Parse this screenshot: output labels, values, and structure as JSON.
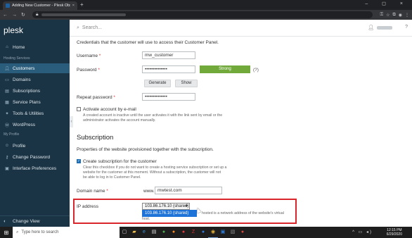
{
  "browser": {
    "tab_title": "Adding New Customer - Plesk Obsidian",
    "tab_close": "×",
    "new_tab": "+",
    "window_controls": "– ◻ ×"
  },
  "sidebar": {
    "logo": "plesk",
    "section_hosting": "Hosting Services",
    "items_hosting": [
      {
        "label": "Home",
        "icon": "home-icon"
      },
      {
        "label": "Customers",
        "icon": "person-icon",
        "active": true
      },
      {
        "label": "Domains",
        "icon": "globe-icon"
      },
      {
        "label": "Subscriptions",
        "icon": "subscriptions-icon"
      },
      {
        "label": "Service Plans",
        "icon": "plans-icon"
      },
      {
        "label": "Tools & Utilities",
        "icon": "tools-icon"
      },
      {
        "label": "WordPress",
        "icon": "wordpress-icon"
      }
    ],
    "section_profile": "My Profile",
    "items_profile": [
      {
        "label": "Profile",
        "icon": "profile-icon"
      },
      {
        "label": "Change Password",
        "icon": "key-icon"
      },
      {
        "label": "Interface Preferences",
        "icon": "preferences-icon"
      }
    ],
    "footer": "Change View"
  },
  "topbar": {
    "search_placeholder": "Search..."
  },
  "form": {
    "intro": "Credentials that the customer will use to access their Customer Panel.",
    "username_label": "Username",
    "username_value": "mw_customer",
    "password_label": "Password",
    "password_value": "••••••••••••••",
    "strength": "Strong",
    "help_mark": "(?)",
    "generate_label": "Generate",
    "show_label": "Show",
    "repeat_label": "Repeat password",
    "repeat_value": "••••••••••••••",
    "activate_label": "Activate account by e-mail",
    "activate_hint_1": "A created account is inactive until the user activates it with the link sent by email or the",
    "activate_hint_2": "administrator activates the account manually.",
    "subscription_heading": "Subscription",
    "subscription_intro": "Properties of the website provisioned together with the subscription.",
    "create_sub_label": "Create subscription for the customer",
    "create_sub_hint_1": "Clear this checkbox if you do not want to create a hosting service subscription or set up a",
    "create_sub_hint_2": "website for the customer at this moment. Without a subscription, the customer will not",
    "create_sub_hint_3": "be able to log in to Customer Panel.",
    "domain_label": "Domain name",
    "domain_prefix": "www.",
    "domain_value": "mwtest.com",
    "ip_label": "IP address",
    "ip_selected": "103.86.176.10 (shared)",
    "ip_option": "103.86.176.10 (shared)",
    "ip_hint_1": "hosted is a network address of the website's virtual",
    "ip_hint_2": "host.",
    "required_mark": "*"
  },
  "taskbar": {
    "search_placeholder": "Type here to search",
    "time": "12:15 PM",
    "date": "6/29/2020"
  }
}
